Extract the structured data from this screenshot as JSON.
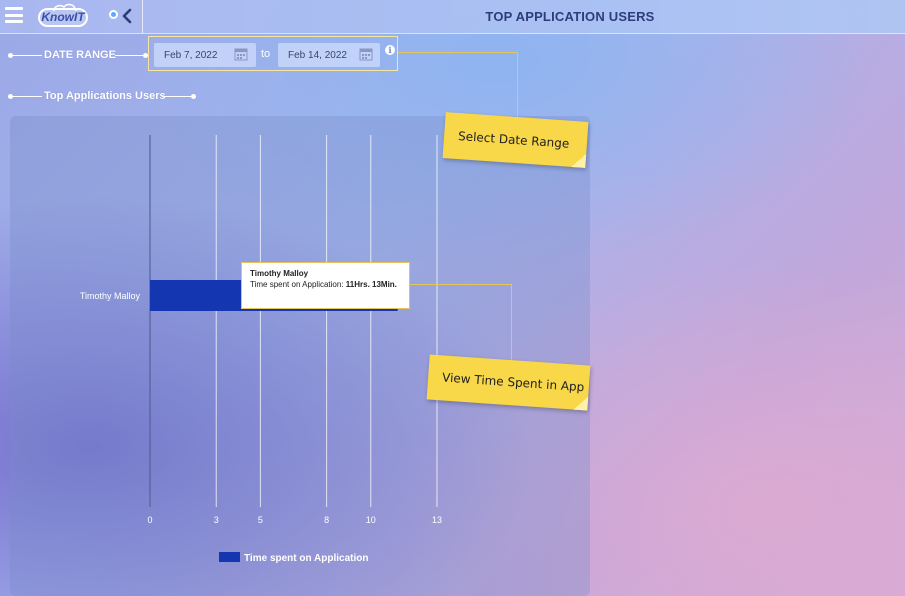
{
  "header": {
    "title": "TOP APPLICATION USERS",
    "logo_text": "KnowIT"
  },
  "filters": {
    "date_range_label": "DATE RANGE",
    "start_date": "Feb 7, 2022",
    "to_label": "to",
    "end_date": "Feb 14, 2022",
    "info_glyph": "i"
  },
  "section": {
    "title": "Top Applications Users"
  },
  "chart_data": {
    "type": "bar",
    "orientation": "horizontal",
    "categories": [
      "Timothy Malloy"
    ],
    "series": [
      {
        "name": "Time spent on Application",
        "values": [
          11.22
        ],
        "color": "#1436b0"
      }
    ],
    "x_ticks": [
      0,
      3,
      5,
      8,
      10,
      13
    ],
    "xlim": [
      0,
      13
    ],
    "grid": true,
    "legend": "bottom"
  },
  "tooltip": {
    "name": "Timothy Malloy",
    "label": "Time spent on Application: ",
    "value": "11Hrs. 13Min."
  },
  "notes": {
    "date_note": "Select Date Range",
    "app_note": "View Time Spent in App"
  },
  "colors": {
    "bar": "#1436b0",
    "note": "#f8d748",
    "title": "#2e3d7a"
  }
}
